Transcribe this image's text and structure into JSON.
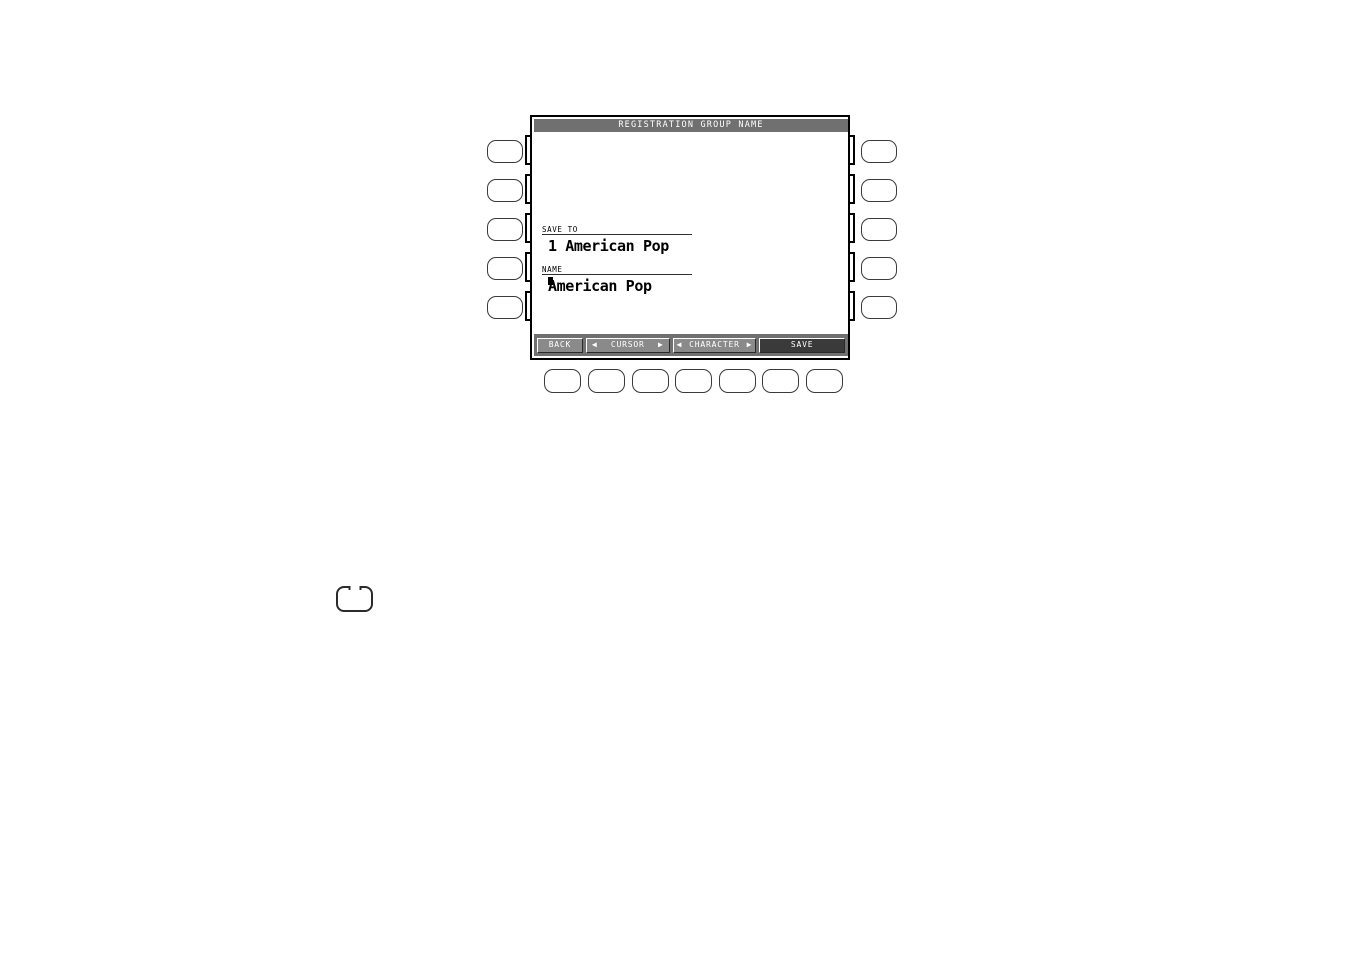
{
  "screen": {
    "title": "REGISTRATION GROUP NAME",
    "fields": [
      {
        "label": "SAVE TO",
        "value": "1 American Pop",
        "has_cursor": false
      },
      {
        "label": "NAME",
        "value": "American Pop",
        "cursor_char": "A",
        "value_rest": "merican Pop",
        "has_cursor": true
      }
    ],
    "softkeys": [
      {
        "id": "back",
        "label": "BACK",
        "left_arrow": "",
        "right_arrow": "",
        "selected": false
      },
      {
        "id": "cursor",
        "label": "CURSOR",
        "left_arrow": "◀",
        "right_arrow": "▶",
        "selected": false
      },
      {
        "id": "character",
        "label": "CHARACTER",
        "left_arrow": "◀",
        "right_arrow": "▶",
        "selected": false
      },
      {
        "id": "save",
        "label": "SAVE",
        "left_arrow": "",
        "right_arrow": "",
        "selected": true
      }
    ]
  },
  "hardware": {
    "left_buttons": [
      "L1",
      "L2",
      "L3",
      "L4",
      "L5"
    ],
    "right_buttons": [
      "R1",
      "R2",
      "R3",
      "R4",
      "R5"
    ],
    "bottom_buttons": [
      "B1",
      "B2",
      "B3",
      "B4",
      "B5",
      "B6",
      "B7"
    ],
    "lone_button": "exit-button"
  },
  "colors": {
    "title_bar": "#707070",
    "softkey_bar": "#707070",
    "softkey_face": "#8a8a8a",
    "softkey_selected": "#3a3a3a",
    "screen_bg": "#ffffff",
    "text": "#000000",
    "bezel": "#000000"
  }
}
